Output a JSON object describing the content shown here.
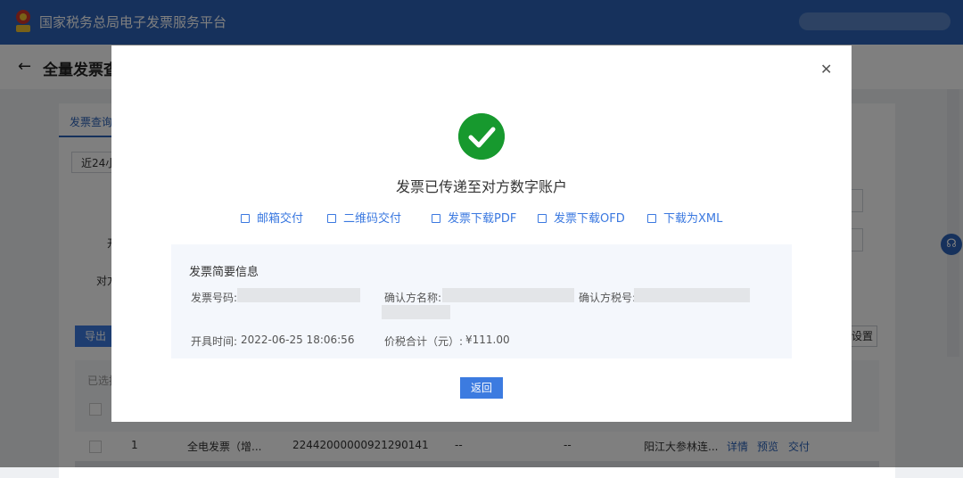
{
  "header": {
    "title": "国家税务总局电子发票服务平台"
  },
  "page": {
    "title": "全量发票查",
    "tab_query": "发票查询",
    "range_select": "近24小",
    "bg_label_1": "开",
    "bg_label_2": "对方",
    "export_button": "导出",
    "settings_button": "设置",
    "selected_label": "已选择"
  },
  "table": {
    "row": {
      "index": "1",
      "type": "全电发票（增...",
      "number": "22442000000921290141",
      "col_a": "--",
      "col_b": "--",
      "buyer": "阳江大参林连...",
      "action_detail": "详情",
      "action_preview": "预览",
      "action_deliver": "交付"
    }
  },
  "modal": {
    "title": "发票已传递至对方数字账户",
    "actions": [
      {
        "label": "邮箱交付"
      },
      {
        "label": "二维码交付"
      },
      {
        "label": "发票下载PDF"
      },
      {
        "label": "发票下载OFD"
      },
      {
        "label": "下载为XML"
      }
    ],
    "info": {
      "title": "发票简要信息",
      "invoice_no_label": "发票号码:",
      "confirm_name_label": "确认方名称:",
      "confirm_tax_label": "确认方税号:",
      "issue_time_label": "开具时间:",
      "issue_time_value": "2022-06-25 18:06:56",
      "total_label": "价税合计（元）:",
      "total_value": "¥111.00"
    },
    "return_button": "返回"
  },
  "colors": {
    "brand_blue": "#2d63b8",
    "link_blue": "#3a78e0",
    "success_green": "#17992e"
  }
}
